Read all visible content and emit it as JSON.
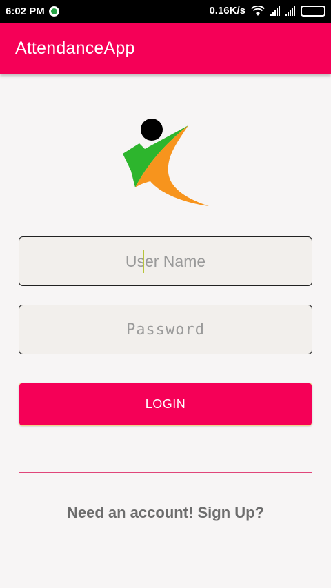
{
  "status_bar": {
    "time": "6:02 PM",
    "speed": "0.16K/s"
  },
  "app_bar": {
    "title": "AttendanceApp"
  },
  "login_form": {
    "username_placeholder": "User Name",
    "password_placeholder": "Password",
    "login_label": "LOGIN",
    "signup_text": "Need an account! Sign Up?"
  },
  "colors": {
    "accent": "#f50057",
    "logo_green": "#2db52d",
    "logo_orange": "#f7941d"
  }
}
